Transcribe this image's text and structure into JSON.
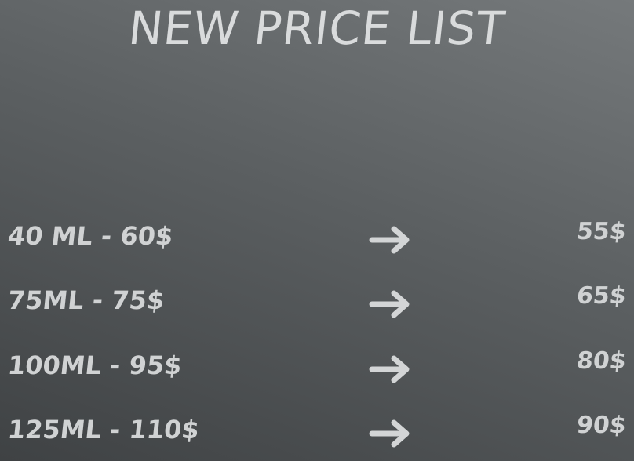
{
  "title": "NEW PRICE LIST",
  "colors": {
    "text": "#d3d5d6",
    "background_top": "#75797b",
    "background_bottom": "#3f4244"
  },
  "rows": [
    {
      "old": "40 ML - 60$",
      "arrow_icon": "right-arrow-icon",
      "new": "55$"
    },
    {
      "old": "75ML - 75$",
      "arrow_icon": "right-arrow-icon",
      "new": "65$"
    },
    {
      "old": "100ML - 95$",
      "arrow_icon": "right-arrow-icon",
      "new": "80$"
    },
    {
      "old": "125ML - 110$",
      "arrow_icon": "right-arrow-icon",
      "new": "90$"
    }
  ]
}
